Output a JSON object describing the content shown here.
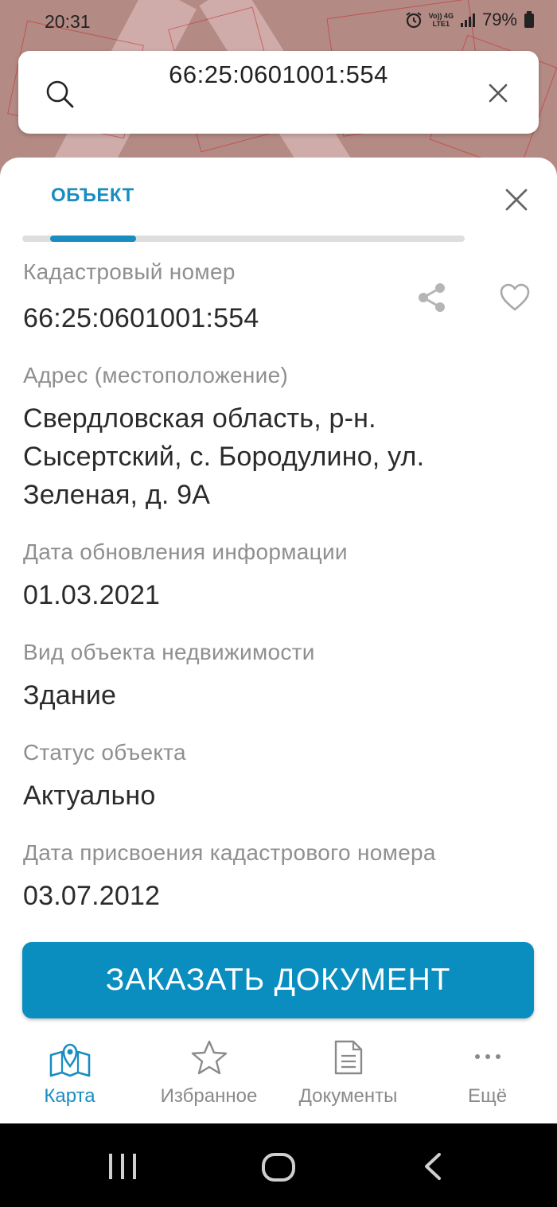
{
  "status_bar": {
    "time": "20:31",
    "battery_percent": "79%",
    "network_top": "Vo)) 4G",
    "network_bottom": "LTE1"
  },
  "search": {
    "query": "66:25:0601001:554"
  },
  "sheet": {
    "tab_label": "ОБЪЕКТ",
    "fields": [
      {
        "label": "Кадастровый номер",
        "value": "66:25:0601001:554"
      },
      {
        "label": "Адрес (местоположение)",
        "value": "Свердловская область, р-н. Сысертский, с. Бородулино, ул. Зеленая, д. 9А"
      },
      {
        "label": "Дата обновления информации",
        "value": "01.03.2021"
      },
      {
        "label": "Вид объекта недвижимости",
        "value": "Здание"
      },
      {
        "label": "Статус объекта",
        "value": "Актуально"
      },
      {
        "label": "Дата присвоения кадастрового номера",
        "value": "03.07.2012"
      }
    ],
    "order_button": "ЗАКАЗАТЬ ДОКУМЕНТ"
  },
  "bottom_nav": {
    "items": [
      {
        "label": "Карта",
        "icon": "map-icon",
        "active": true
      },
      {
        "label": "Избранное",
        "icon": "star-icon",
        "active": false
      },
      {
        "label": "Документы",
        "icon": "document-icon",
        "active": false
      },
      {
        "label": "Ещё",
        "icon": "more-icon",
        "active": false
      }
    ]
  },
  "colors": {
    "accent": "#1a8dc0",
    "button": "#0a8dbf"
  }
}
